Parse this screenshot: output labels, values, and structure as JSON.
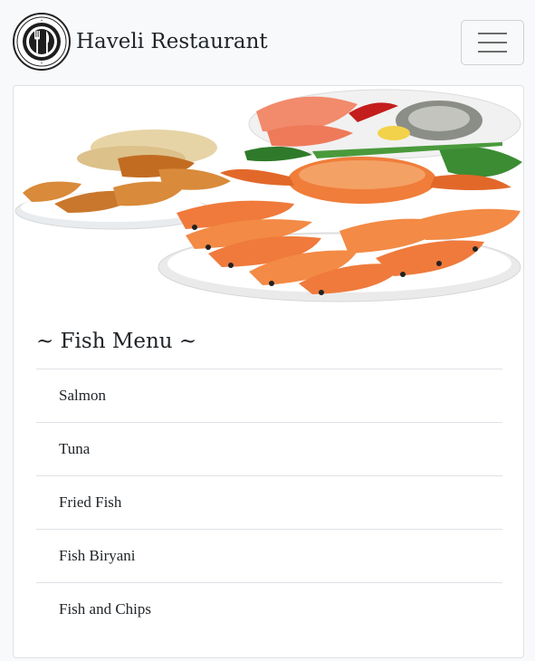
{
  "navbar": {
    "brand_name": "Haveli Restaurant",
    "logo_icon": "fork-knife-plate-icon",
    "toggler_icon": "hamburger-menu-icon"
  },
  "card": {
    "image": "seafood-platter-image",
    "title": "~ Fish Menu ~",
    "items": [
      {
        "label": "Salmon"
      },
      {
        "label": "Tuna"
      },
      {
        "label": "Fried Fish"
      },
      {
        "label": "Fish Biryani"
      },
      {
        "label": "Fish and Chips"
      }
    ]
  },
  "colors": {
    "navbar_bg": "#f8f9fa",
    "divider": "#dee2e6",
    "shrimp": "#ef7a3c",
    "crab": "#f07d3a"
  }
}
